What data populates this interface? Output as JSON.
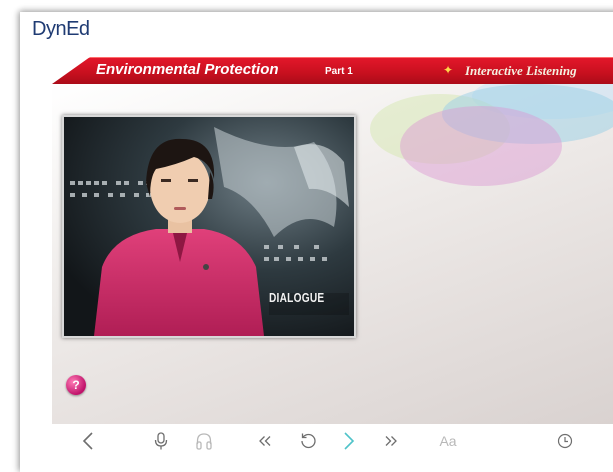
{
  "app": {
    "logo_text": "DynEd"
  },
  "banner": {
    "title": "Environmental Protection",
    "part": "Part 1",
    "module": "Interactive Listening"
  },
  "video": {
    "caption": "DIALOGUE"
  },
  "help": {
    "label": "?"
  },
  "toolbar": {
    "font_label": "Aa",
    "items": [
      "back",
      "microphone",
      "headphones",
      "rewind",
      "repeat",
      "next",
      "fast-forward",
      "font-size",
      "timer"
    ]
  },
  "colors": {
    "banner_red": "#c8101f",
    "logo_blue": "#1f3b73",
    "next_arrow": "#4fc3c9",
    "help_pink": "#c0126a"
  }
}
